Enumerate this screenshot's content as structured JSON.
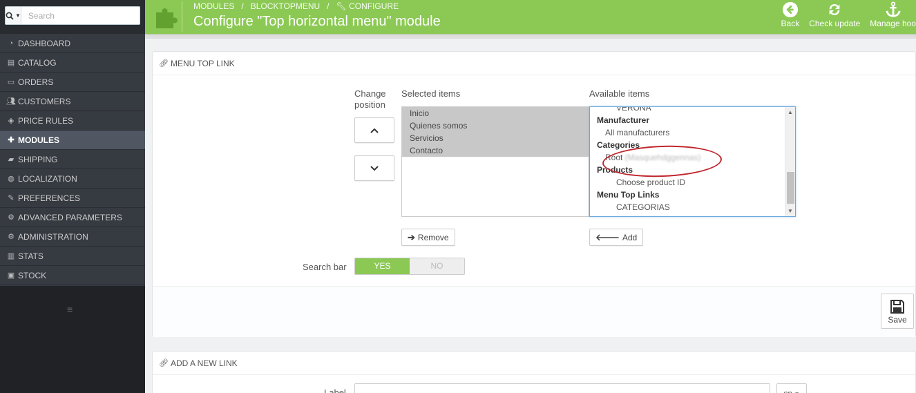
{
  "search": {
    "placeholder": "Search",
    "button_icon": "search-icon"
  },
  "sidebar": {
    "items": [
      {
        "label": "DASHBOARD",
        "icon": "dashboard-icon",
        "active": false
      },
      {
        "label": "CATALOG",
        "icon": "book-icon",
        "active": false
      },
      {
        "label": "ORDERS",
        "icon": "credit-card-icon",
        "active": false
      },
      {
        "label": "CUSTOMERS",
        "icon": "users-icon",
        "active": false
      },
      {
        "label": "PRICE RULES",
        "icon": "tags-icon",
        "active": false
      },
      {
        "label": "MODULES",
        "icon": "puzzle-icon",
        "active": true
      },
      {
        "label": "SHIPPING",
        "icon": "truck-icon",
        "active": false
      },
      {
        "label": "LOCALIZATION",
        "icon": "globe-icon",
        "active": false
      },
      {
        "label": "PREFERENCES",
        "icon": "wrench-icon",
        "active": false
      },
      {
        "label": "ADVANCED PARAMETERS",
        "icon": "cogs-icon",
        "active": false
      },
      {
        "label": "ADMINISTRATION",
        "icon": "cog-icon",
        "active": false
      },
      {
        "label": "STATS",
        "icon": "bar-chart-icon",
        "active": false
      },
      {
        "label": "STOCK",
        "icon": "archive-icon",
        "active": false
      }
    ]
  },
  "header": {
    "breadcrumb": [
      "MODULES",
      "/",
      "BLOCKTOPMENU",
      "/",
      "CONFIGURE"
    ],
    "title": "Configure \"Top horizontal menu\" module",
    "toolbar": [
      {
        "label": "Back",
        "icon": "arrow-circle-left-icon"
      },
      {
        "label": "Check update",
        "icon": "refresh-icon"
      },
      {
        "label": "Manage hoo",
        "icon": "anchor-icon"
      }
    ],
    "accent": "#8bc954"
  },
  "panel_menu_top_link": {
    "heading": "MENU TOP LINK",
    "change_position_label": [
      "Change",
      "position"
    ],
    "selected_items_label": "Selected items",
    "available_items_label": "Available items",
    "selected_items": [
      "Inicio",
      "Quienes somos",
      "Servicios",
      "Contacto"
    ],
    "available_items": [
      {
        "text": "VERONA",
        "level": 2
      },
      {
        "text": "Manufacturer",
        "level": 0
      },
      {
        "text": "All manufacturers",
        "level": 1
      },
      {
        "text": "Categories",
        "level": 0
      },
      {
        "text": "Root",
        "level": 1,
        "blurred_suffix": "(Masquehdggennas)"
      },
      {
        "text": "Products",
        "level": 0
      },
      {
        "text": "Choose product ID",
        "level": 2
      },
      {
        "text": "Menu Top Links",
        "level": 0
      },
      {
        "text": "CATEGORIAS",
        "level": 2
      }
    ],
    "remove_label": "Remove",
    "add_label": "Add",
    "search_bar_label": "Search bar",
    "switch_yes": "YES",
    "switch_no": "NO",
    "save_label": "Save"
  },
  "panel_add_link": {
    "heading": "ADD A NEW LINK",
    "label_field": "Label",
    "lang": "en"
  }
}
